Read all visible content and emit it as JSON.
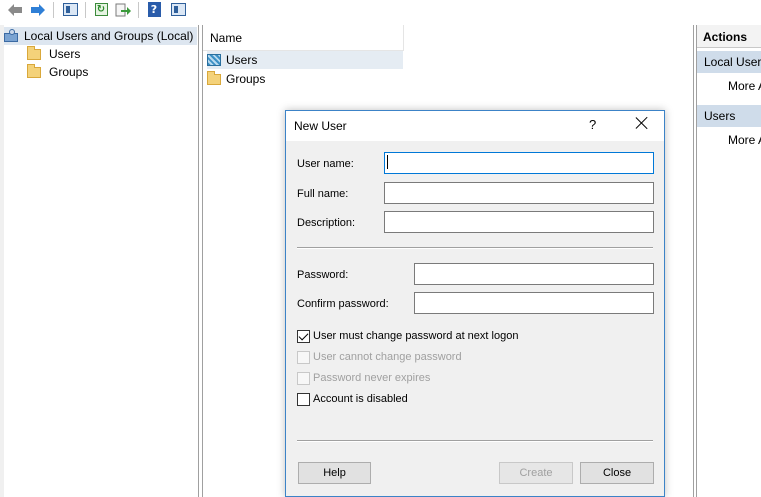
{
  "toolbar": {
    "icons": [
      "back-arrow-icon",
      "forward-arrow-icon",
      "show-hide-console-tree-icon",
      "refresh-icon",
      "export-list-icon",
      "help-icon",
      "show-hide-action-pane-icon"
    ]
  },
  "tree": {
    "root_label": "Local Users and Groups (Local)",
    "items": [
      {
        "label": "Users"
      },
      {
        "label": "Groups"
      }
    ]
  },
  "list": {
    "column_name": "Name",
    "items": [
      {
        "label": "Users"
      },
      {
        "label": "Groups"
      }
    ]
  },
  "actions": {
    "title": "Actions",
    "sections": [
      {
        "label": "Local Users",
        "item": "More A"
      },
      {
        "label": "Users",
        "item": "More A"
      }
    ]
  },
  "dialog": {
    "title": "New User",
    "help_label": "?",
    "fields": {
      "username_label": "User name:",
      "username_value": "",
      "fullname_label": "Full name:",
      "fullname_value": "",
      "description_label": "Description:",
      "description_value": "",
      "password_label": "Password:",
      "password_value": "",
      "confirm_label": "Confirm password:",
      "confirm_value": ""
    },
    "checkboxes": {
      "must_change": {
        "label": "User must change password at next logon",
        "checked": true,
        "enabled": true
      },
      "cannot_change": {
        "label": "User cannot change password",
        "checked": false,
        "enabled": false
      },
      "never_expires": {
        "label": "Password never expires",
        "checked": false,
        "enabled": false
      },
      "disabled": {
        "label": "Account is disabled",
        "checked": false,
        "enabled": true
      }
    },
    "buttons": {
      "help": "Help",
      "create": "Create",
      "close": "Close"
    }
  },
  "colors": {
    "accent": "#0078d7",
    "dialog_border": "#3c83c7",
    "section_bg": "#cfdcea",
    "selection_bg": "#e5ecf3"
  }
}
